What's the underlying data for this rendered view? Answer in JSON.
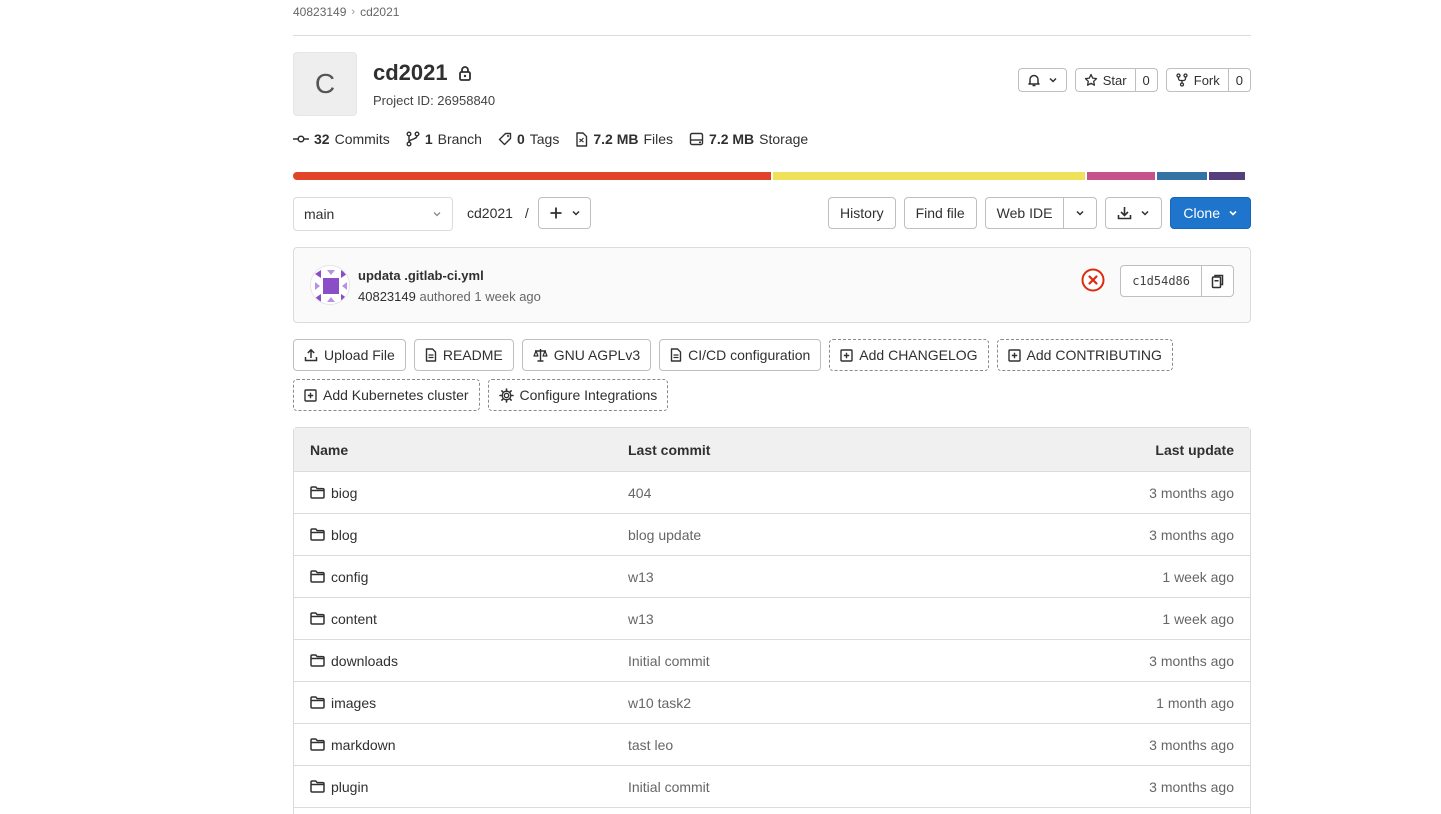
{
  "breadcrumb": {
    "owner": "40823149",
    "project": "cd2021"
  },
  "project": {
    "avatar_letter": "C",
    "name": "cd2021",
    "id_label": "Project ID: 26958840"
  },
  "header_actions": {
    "star_label": "Star",
    "star_count": "0",
    "fork_label": "Fork",
    "fork_count": "0"
  },
  "stats": [
    {
      "value": "32",
      "label": "Commits",
      "icon": "commit-icon"
    },
    {
      "value": "1",
      "label": "Branch",
      "icon": "branch-icon"
    },
    {
      "value": "0",
      "label": "Tags",
      "icon": "tag-icon"
    },
    {
      "value": "7.2 MB",
      "label": "Files",
      "icon": "file-icon"
    },
    {
      "value": "7.2 MB",
      "label": "Storage",
      "icon": "storage-icon"
    }
  ],
  "language_bar": [
    {
      "color": "#e24329",
      "share": 0.503
    },
    {
      "color": "#f1e05a",
      "share": 0.329
    },
    {
      "color": "#c6538c",
      "share": 0.071
    },
    {
      "color": "#3572a5",
      "share": 0.053
    },
    {
      "color": "#563d7c",
      "share": 0.038
    }
  ],
  "toolbar": {
    "branch": "main",
    "path": "cd2021",
    "path_sep": "/",
    "history": "History",
    "find_file": "Find file",
    "web_ide": "Web IDE",
    "clone": "Clone"
  },
  "last_commit": {
    "title": "updata .gitlab-ci.yml",
    "author": "40823149",
    "meta": "authored 1 week ago",
    "sha": "c1d54d86",
    "status_color": "#dd2b0e"
  },
  "quick_actions": {
    "row1": [
      {
        "label": "Upload File",
        "icon": "upload-icon",
        "style": "solid"
      },
      {
        "label": "README",
        "icon": "doc-icon",
        "style": "solid"
      },
      {
        "label": "GNU AGPLv3",
        "icon": "scale-icon",
        "style": "solid"
      },
      {
        "label": "CI/CD configuration",
        "icon": "doc-icon",
        "style": "solid"
      },
      {
        "label": "Add CHANGELOG",
        "icon": "plus-square-icon",
        "style": "dashed"
      },
      {
        "label": "Add CONTRIBUTING",
        "icon": "plus-square-icon",
        "style": "dashed"
      }
    ],
    "row2": [
      {
        "label": "Add Kubernetes cluster",
        "icon": "plus-square-icon",
        "style": "dashed"
      },
      {
        "label": "Configure Integrations",
        "icon": "gear-icon",
        "style": "dashed"
      }
    ]
  },
  "file_table": {
    "headers": {
      "name": "Name",
      "last_commit": "Last commit",
      "last_update": "Last update"
    },
    "rows": [
      {
        "name": "biog",
        "commit": "404",
        "updated": "3 months ago"
      },
      {
        "name": "blog",
        "commit": "blog update",
        "updated": "3 months ago"
      },
      {
        "name": "config",
        "commit": "w13",
        "updated": "1 week ago"
      },
      {
        "name": "content",
        "commit": "w13",
        "updated": "1 week ago"
      },
      {
        "name": "downloads",
        "commit": "Initial commit",
        "updated": "3 months ago"
      },
      {
        "name": "images",
        "commit": "w10 task2",
        "updated": "1 month ago"
      },
      {
        "name": "markdown",
        "commit": "tast leo",
        "updated": "3 months ago"
      },
      {
        "name": "plugin",
        "commit": "Initial commit",
        "updated": "3 months ago"
      },
      {
        "name": "",
        "commit": "",
        "updated": ""
      }
    ]
  }
}
